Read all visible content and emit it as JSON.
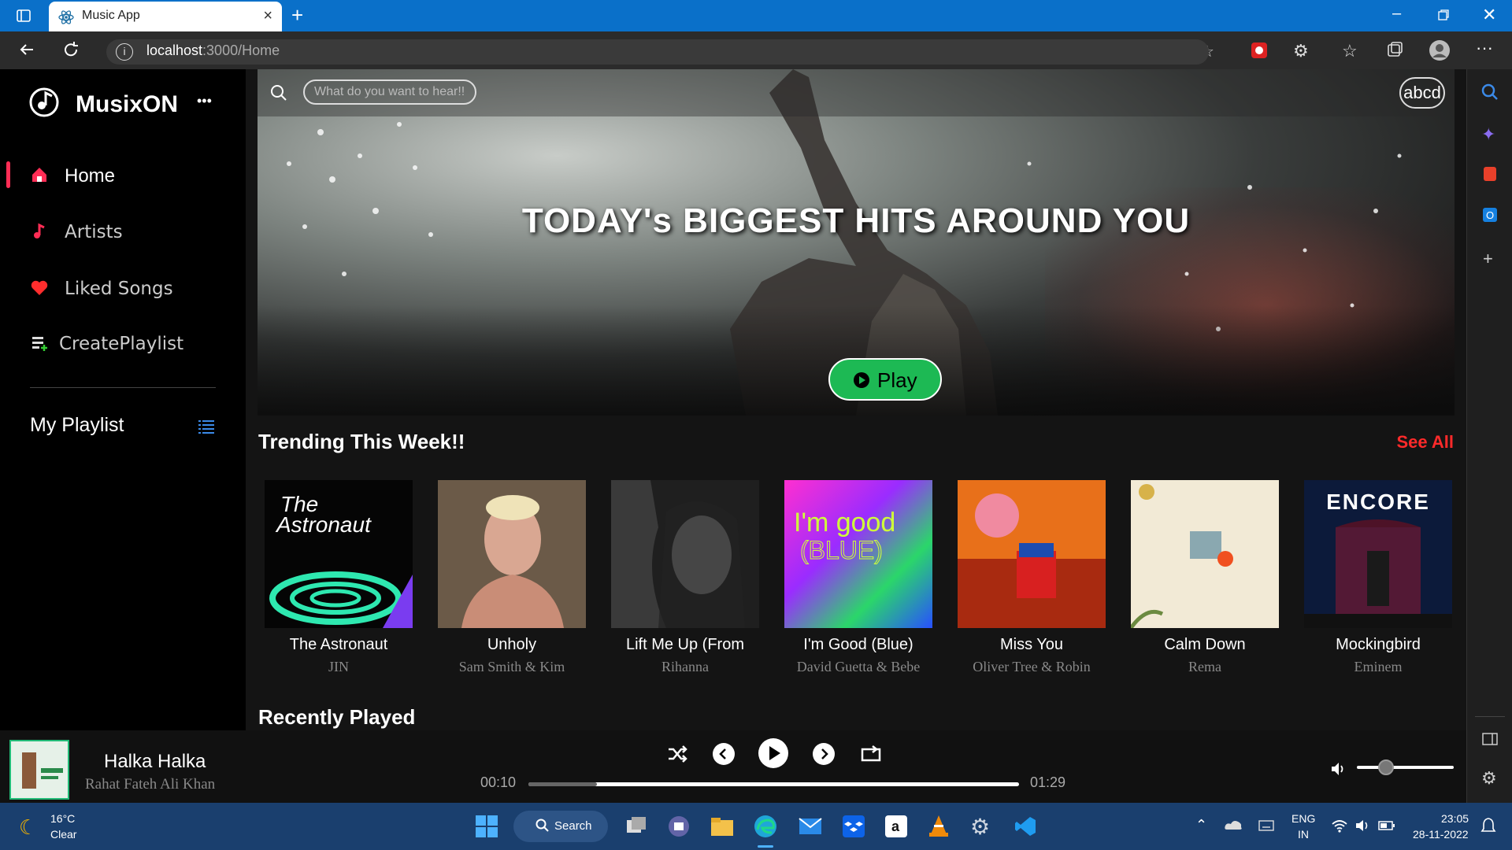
{
  "browser": {
    "tab_title": "Music App",
    "url_host": "localhost",
    "url_rest": ":3000/Home"
  },
  "sidebar": {
    "brand": "MusixON",
    "more": "•••",
    "items": [
      {
        "label": "Home",
        "icon": "home-icon",
        "active": true
      },
      {
        "label": "Artists",
        "icon": "music-note-icon",
        "active": false
      },
      {
        "label": "Liked Songs",
        "icon": "heart-icon",
        "active": false
      },
      {
        "label": "CreatePlaylist",
        "icon": "playlist-add-icon",
        "active": false
      }
    ],
    "my_playlist": "My Playlist"
  },
  "search": {
    "placeholder": "What do you want to hear!!"
  },
  "user": {
    "badge": "abcd"
  },
  "hero": {
    "title": "TODAY's BIGGEST HITS AROUND YOU",
    "play_label": "Play"
  },
  "trending": {
    "title": "Trending This Week!!",
    "see_all": "See All",
    "songs": [
      {
        "name": "The Astronaut",
        "artist": "JIN"
      },
      {
        "name": "Unholy",
        "artist": "Sam Smith & Kim"
      },
      {
        "name": "Lift Me Up (From",
        "artist": "Rihanna"
      },
      {
        "name": "I'm Good (Blue)",
        "artist": "David Guetta & Bebe"
      },
      {
        "name": "Miss You",
        "artist": "Oliver Tree & Robin"
      },
      {
        "name": "Calm Down",
        "artist": "Rema"
      },
      {
        "name": "Mockingbird",
        "artist": "Eminem"
      }
    ]
  },
  "recently": {
    "title": "Recently Played"
  },
  "player": {
    "title": "Halka Halka",
    "artist": "Rahat Fateh Ali Khan",
    "current_time": "00:10",
    "total_time": "01:29",
    "progress": 0.14,
    "volume": 0.3
  },
  "taskbar": {
    "temp": "16°C",
    "weather": "Clear",
    "search": "Search",
    "lang1": "ENG",
    "lang2": "IN",
    "time": "23:05",
    "date": "28-11-2022"
  },
  "colors": {
    "accent": "#1db954",
    "see_all": "#ff2a2a",
    "nav_icon": "#ff2d55"
  }
}
